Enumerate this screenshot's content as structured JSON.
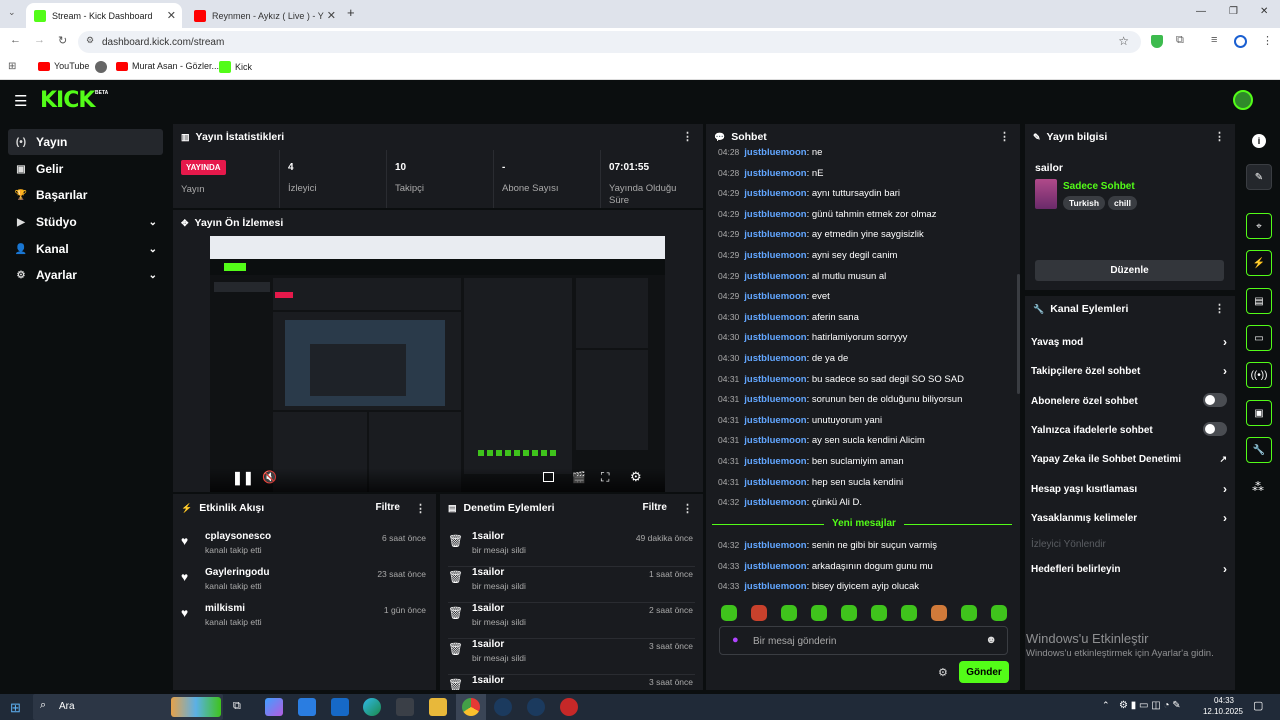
{
  "browser": {
    "tabs": [
      {
        "title": "Stream - Kick Dashboard"
      },
      {
        "title": "Reynmen - Aykız ( Live ) - Y"
      }
    ],
    "url": "dashboard.kick.com/stream",
    "bookmarks": [
      "YouTube",
      "Murat Asan - Gözler...",
      "Kick"
    ]
  },
  "kick": {
    "logo": "KICK",
    "beta": "BETA"
  },
  "nav": [
    {
      "label": "Yayın",
      "icon": "(•)"
    },
    {
      "label": "Gelir",
      "icon": "▣"
    },
    {
      "label": "Başarılar",
      "icon": "🏆"
    },
    {
      "label": "Stüdyo",
      "icon": "▶"
    },
    {
      "label": "Kanal",
      "icon": "👤"
    },
    {
      "label": "Ayarlar",
      "icon": "⚙"
    }
  ],
  "stats": {
    "title": "Yayın İstatistikleri",
    "live_badge": "YAYINDA",
    "items": [
      {
        "value": "",
        "label": "Yayın"
      },
      {
        "value": "4",
        "label": "İzleyici"
      },
      {
        "value": "10",
        "label": "Takipçi"
      },
      {
        "value": "-",
        "label": "Abone Sayısı"
      },
      {
        "value": "07:01:55",
        "label": "Yayında Olduğu Süre"
      }
    ]
  },
  "preview": {
    "title": "Yayın Ön İzlemesi"
  },
  "activity": {
    "title": "Etkinlik Akışı",
    "filter": "Filtre",
    "items": [
      {
        "name": "cplaysonesco",
        "desc": "kanalı takip etti",
        "time": "6 saat önce"
      },
      {
        "name": "Gayleringodu",
        "desc": "kanalı takip etti",
        "time": "23 saat önce"
      },
      {
        "name": "milkismi",
        "desc": "kanalı takip etti",
        "time": "1 gün önce"
      }
    ]
  },
  "moderation": {
    "title": "Denetim Eylemleri",
    "filter": "Filtre",
    "items": [
      {
        "name": "1sailor",
        "desc": "bir mesajı sildi",
        "time": "49 dakika önce"
      },
      {
        "name": "1sailor",
        "desc": "bir mesajı sildi",
        "time": "1 saat önce"
      },
      {
        "name": "1sailor",
        "desc": "bir mesajı sildi",
        "time": "2 saat önce"
      },
      {
        "name": "1sailor",
        "desc": "bir mesajı sildi",
        "time": "3 saat önce"
      },
      {
        "name": "1sailor",
        "desc": "",
        "time": "3 saat önce"
      }
    ]
  },
  "chat": {
    "title": "Sohbet",
    "new_messages": "Yeni mesajlar",
    "placeholder": "Bir mesaj gönderin",
    "send": "Gönder",
    "messages": [
      {
        "t": "04:28",
        "u": "justbluemoon",
        "m": "ne"
      },
      {
        "t": "04:28",
        "u": "justbluemoon",
        "m": "nE"
      },
      {
        "t": "04:29",
        "u": "justbluemoon",
        "m": "aynı tuttursaydin bari"
      },
      {
        "t": "04:29",
        "u": "justbluemoon",
        "m": "günü tahmin etmek zor olmaz"
      },
      {
        "t": "04:29",
        "u": "justbluemoon",
        "m": "ay etmedin yine saygisizlik"
      },
      {
        "t": "04:29",
        "u": "justbluemoon",
        "m": "ayni sey degil canim"
      },
      {
        "t": "04:29",
        "u": "justbluemoon",
        "m": "al mutlu musun al"
      },
      {
        "t": "04:29",
        "u": "justbluemoon",
        "m": "evet"
      },
      {
        "t": "04:30",
        "u": "justbluemoon",
        "m": "aferin sana"
      },
      {
        "t": "04:30",
        "u": "justbluemoon",
        "m": "hatirlamiyorum sorryyy"
      },
      {
        "t": "04:30",
        "u": "justbluemoon",
        "m": "de ya de"
      },
      {
        "t": "04:31",
        "u": "justbluemoon",
        "m": "bu sadece so sad degil SO SO SAD"
      },
      {
        "t": "04:31",
        "u": "justbluemoon",
        "m": "sorunun ben de olduğunu biliyorsun"
      },
      {
        "t": "04:31",
        "u": "justbluemoon",
        "m": "unutuyorum yani"
      },
      {
        "t": "04:31",
        "u": "justbluemoon",
        "m": "ay sen sucla kendini Alicim"
      },
      {
        "t": "04:31",
        "u": "justbluemoon",
        "m": "ben suclamiyim aman"
      },
      {
        "t": "04:31",
        "u": "justbluemoon",
        "m": "hep sen sucla kendini"
      },
      {
        "t": "04:32",
        "u": "justbluemoon",
        "m": "çünkü Ali D."
      }
    ],
    "new": [
      {
        "t": "04:32",
        "u": "justbluemoon",
        "m": "senin ne gibi bir suçun varmiş"
      },
      {
        "t": "04:33",
        "u": "justbluemoon",
        "m": "arkadaşının dogum gunu mu"
      },
      {
        "t": "04:33",
        "u": "justbluemoon",
        "m": "bisey diyicem ayip olucak"
      }
    ]
  },
  "info": {
    "title": "Yayın bilgisi",
    "streamer": "sailor",
    "stream_title": "Sadece Sohbet",
    "tags": [
      "Turkish",
      "chill"
    ],
    "edit": "Düzenle"
  },
  "actions": {
    "title": "Kanal Eylemleri",
    "items": [
      {
        "label": "Yavaş mod",
        "kind": "chev"
      },
      {
        "label": "Takipçilere özel sohbet",
        "kind": "chev"
      },
      {
        "label": "Abonelere özel sohbet",
        "kind": "toggle"
      },
      {
        "label": "Yalnızca ifadelerle sohbet",
        "kind": "toggle"
      },
      {
        "label": "Yapay Zeka ile Sohbet Denetimi",
        "kind": "ext"
      },
      {
        "label": "Hesap yaşı kısıtlaması",
        "kind": "chev"
      },
      {
        "label": "Yasaklanmış kelimeler",
        "kind": "chev"
      },
      {
        "label": "İzleyici Yönlendir",
        "kind": "disabled"
      },
      {
        "label": "Hedefleri belirleyin",
        "kind": "chev"
      }
    ]
  },
  "watermark": {
    "line1": "Windows'u Etkinleştir",
    "line2": "Windows'u etkinleştirmek için Ayarlar'a gidin."
  },
  "taskbar": {
    "search": "Ara",
    "time": "04:33",
    "date": "12.10.2025"
  },
  "colors": {
    "accent": "#53fc18",
    "live": "#e6194b",
    "username": "#62a6ff"
  }
}
